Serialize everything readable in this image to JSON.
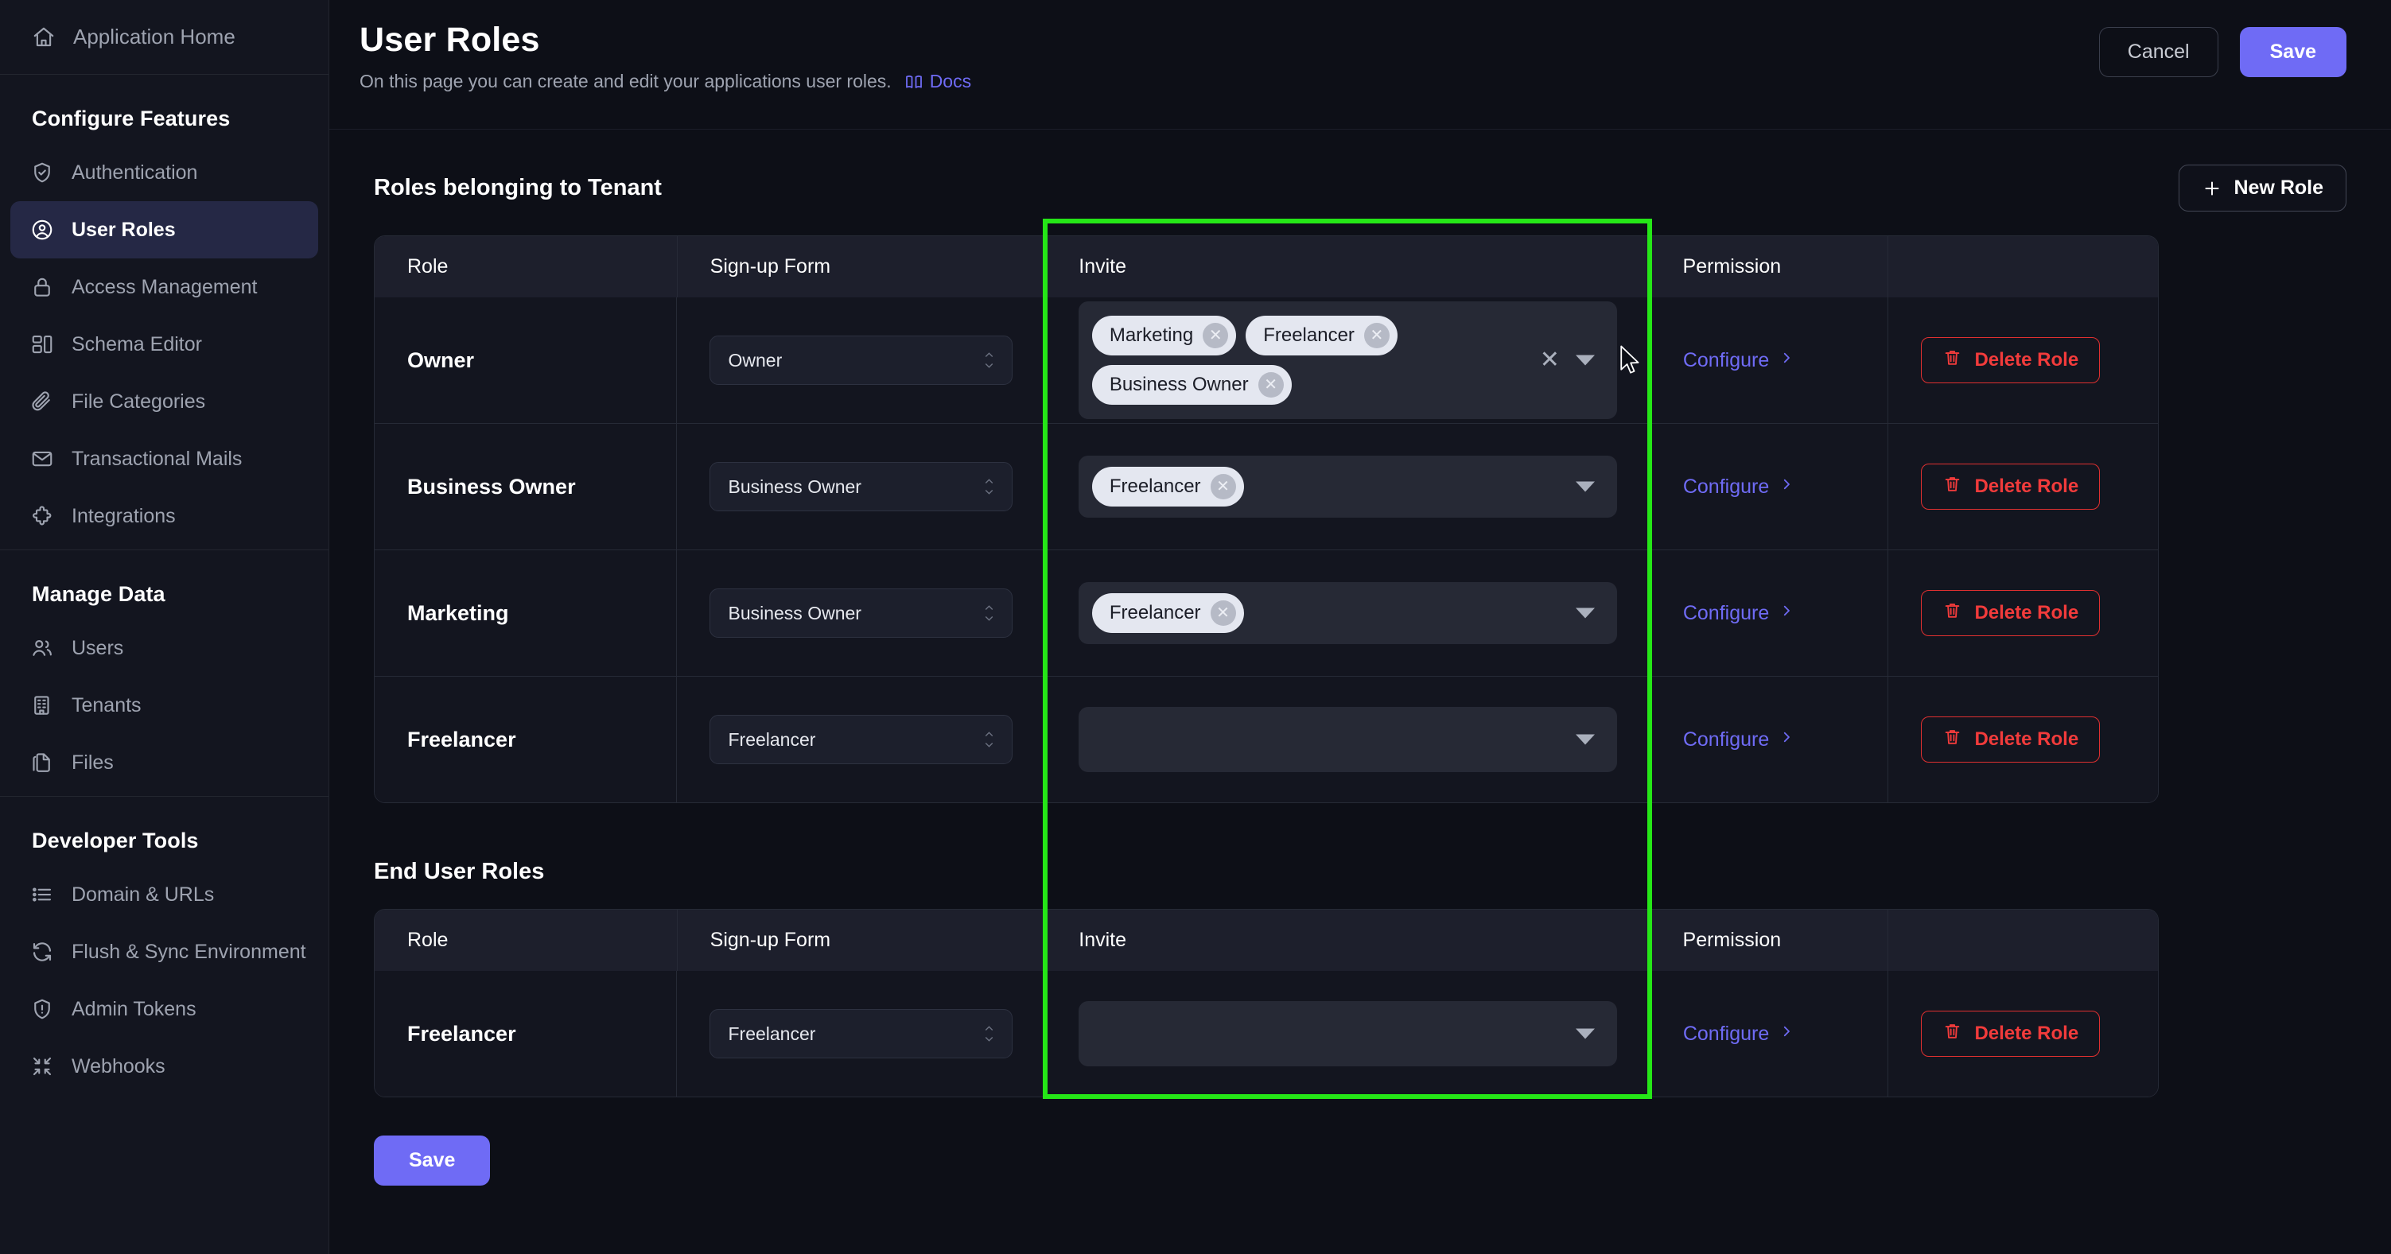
{
  "sidebar": {
    "home": {
      "label": "Application Home",
      "icon": "home-icon"
    },
    "groups": [
      {
        "title": "Configure Features",
        "items": [
          {
            "label": "Authentication",
            "icon": "shield-check-icon",
            "active": false
          },
          {
            "label": "User Roles",
            "icon": "user-circle-icon",
            "active": true
          },
          {
            "label": "Access Management",
            "icon": "lock-icon",
            "active": false
          },
          {
            "label": "Schema Editor",
            "icon": "schema-icon",
            "active": false
          },
          {
            "label": "File Categories",
            "icon": "paperclip-icon",
            "active": false
          },
          {
            "label": "Transactional Mails",
            "icon": "mail-icon",
            "active": false
          },
          {
            "label": "Integrations",
            "icon": "puzzle-icon",
            "active": false
          }
        ]
      },
      {
        "title": "Manage Data",
        "items": [
          {
            "label": "Users",
            "icon": "users-icon",
            "active": false
          },
          {
            "label": "Tenants",
            "icon": "building-icon",
            "active": false
          },
          {
            "label": "Files",
            "icon": "files-icon",
            "active": false
          }
        ]
      },
      {
        "title": "Developer Tools",
        "items": [
          {
            "label": "Domain & URLs",
            "icon": "list-icon",
            "active": false
          },
          {
            "label": "Flush & Sync Environment",
            "icon": "refresh-icon",
            "active": false
          },
          {
            "label": "Admin Tokens",
            "icon": "shield-alert-icon",
            "active": false
          },
          {
            "label": "Webhooks",
            "icon": "collapse-icon",
            "active": false
          }
        ]
      }
    ]
  },
  "header": {
    "title": "User Roles",
    "subtitle": "On this page you can create and edit your applications user roles.",
    "docs_label": "Docs",
    "docs_icon": "book-icon",
    "cancel_label": "Cancel",
    "save_label": "Save",
    "accent_color": "#6f6bf5"
  },
  "tenant_section": {
    "title": "Roles belonging to Tenant",
    "new_role_label": "New Role",
    "new_role_icon": "plus-icon",
    "columns": [
      "Role",
      "Sign-up Form",
      "Invite",
      "Permission",
      ""
    ],
    "rows": [
      {
        "role": "Owner",
        "signup_form": "Owner",
        "invite_chips": [
          "Marketing",
          "Freelancer",
          "Business Owner"
        ],
        "has_clear": true,
        "permission_label": "Configure",
        "delete_label": "Delete Role"
      },
      {
        "role": "Business Owner",
        "signup_form": "Business Owner",
        "invite_chips": [
          "Freelancer"
        ],
        "has_clear": false,
        "permission_label": "Configure",
        "delete_label": "Delete Role"
      },
      {
        "role": "Marketing",
        "signup_form": "Business Owner",
        "invite_chips": [
          "Freelancer"
        ],
        "has_clear": false,
        "permission_label": "Configure",
        "delete_label": "Delete Role"
      },
      {
        "role": "Freelancer",
        "signup_form": "Freelancer",
        "invite_chips": [],
        "has_clear": false,
        "permission_label": "Configure",
        "delete_label": "Delete Role"
      }
    ]
  },
  "enduser_section": {
    "title": "End User Roles",
    "columns": [
      "Role",
      "Sign-up Form",
      "Invite",
      "Permission",
      ""
    ],
    "rows": [
      {
        "role": "Freelancer",
        "signup_form": "Freelancer",
        "invite_chips": [],
        "has_clear": false,
        "permission_label": "Configure",
        "delete_label": "Delete Role"
      }
    ]
  },
  "footer": {
    "save_label": "Save"
  },
  "highlight": {
    "color": "#25e617",
    "target_column": "Invite"
  }
}
